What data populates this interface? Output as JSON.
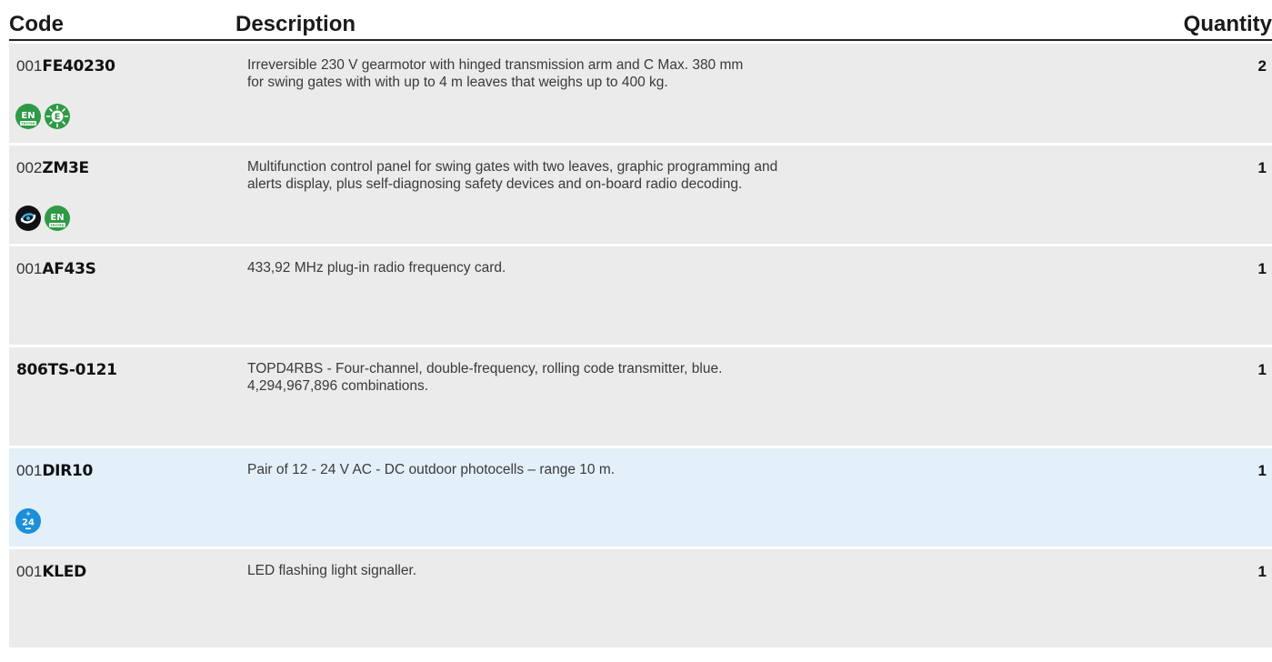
{
  "header": {
    "code": "Code",
    "description": "Description",
    "quantity": "Quantity"
  },
  "rows": [
    {
      "prefix": "001",
      "code": "FE40230",
      "desc_lines": [
        "Irreversible 230 V gearmotor with hinged transmission arm and C Max. 380 mm",
        "for swing gates with with up to 4 m leaves that weighs up to 400 kg."
      ],
      "qty": "2",
      "badges": [
        {
          "icon": "en-tested-icon",
          "text": "EN",
          "sub": "TESTED"
        },
        {
          "icon": "energy-saving-icon",
          "text": "E"
        }
      ]
    },
    {
      "prefix": "002",
      "code": "ZM3E",
      "desc_lines": [
        "Multifunction control panel for swing gates with two leaves, graphic programming and",
        "alerts display, plus self-diagnosing safety devices and on-board radio decoding."
      ],
      "qty": "1",
      "badges": [
        {
          "icon": "connect-icon"
        },
        {
          "icon": "en-tested-icon",
          "text": "EN",
          "sub": "TESTED"
        }
      ]
    },
    {
      "prefix": "001",
      "code": "AF43S",
      "desc_lines": [
        "433,92 MHz plug-in radio frequency card."
      ],
      "qty": "1",
      "badges": []
    },
    {
      "prefix": "",
      "code": "806TS-0121",
      "desc_lines": [
        "TOPD4RBS - Four-channel, double-frequency, rolling code transmitter, blue.",
        "4,294,967,896 combinations."
      ],
      "qty": "1",
      "badges": []
    },
    {
      "prefix": "001",
      "code": "DIR10",
      "desc_lines": [
        "Pair of 12 - 24 V AC - DC  outdoor photocells – range 10 m."
      ],
      "qty": "1",
      "badges": [
        {
          "icon": "24v-icon",
          "text": "24"
        }
      ]
    },
    {
      "prefix": "001",
      "code": "KLED",
      "desc_lines": [
        "LED flashing light signaller."
      ],
      "qty": "1",
      "badges": []
    }
  ],
  "colors": {
    "row_bg": "#ebebeb",
    "row_highlight_bg": "#e3f0f9",
    "badge_green": "#2e9a46",
    "badge_blue": "#1b8fd8",
    "badge_dark": "#111111"
  }
}
